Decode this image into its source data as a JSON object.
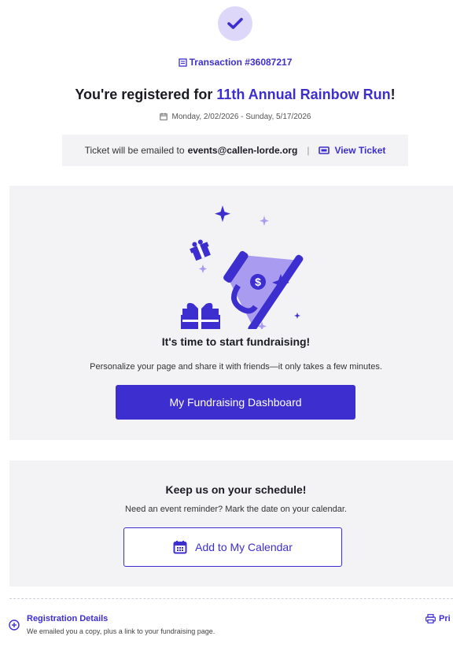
{
  "header": {
    "transaction": "Transaction #36087217",
    "title_prefix": "You're registered for ",
    "event_name": "11th Annual Rainbow Run",
    "title_suffix": "!",
    "dates": "Monday, 2/02/2026 - Sunday, 5/17/2026"
  },
  "ticket": {
    "text": "Ticket will be emailed to",
    "email": "events@callen-lorde.org",
    "separator": "|",
    "view_label": "View Ticket"
  },
  "fundraising": {
    "title": "It's time to start fundraising!",
    "subtitle": "Personalize your page and share it with friends—it only takes a few minutes.",
    "button_label": "My Fundraising Dashboard",
    "art_icon": "megaphone-gift-illustration"
  },
  "calendar": {
    "title": "Keep us on your schedule!",
    "subtitle": "Need an event reminder? Mark the date on your calendar.",
    "button_label": "Add to My Calendar"
  },
  "registration": {
    "title": "Registration Details",
    "subtitle": "We emailed you a copy, plus a link to your fundraising page.",
    "print_label": "Pri"
  },
  "colors": {
    "accent": "#3d2ecf",
    "card_bg": "#f3f3f6",
    "check_bg": "#ddd8fa",
    "art_light": "#a99cf0"
  }
}
